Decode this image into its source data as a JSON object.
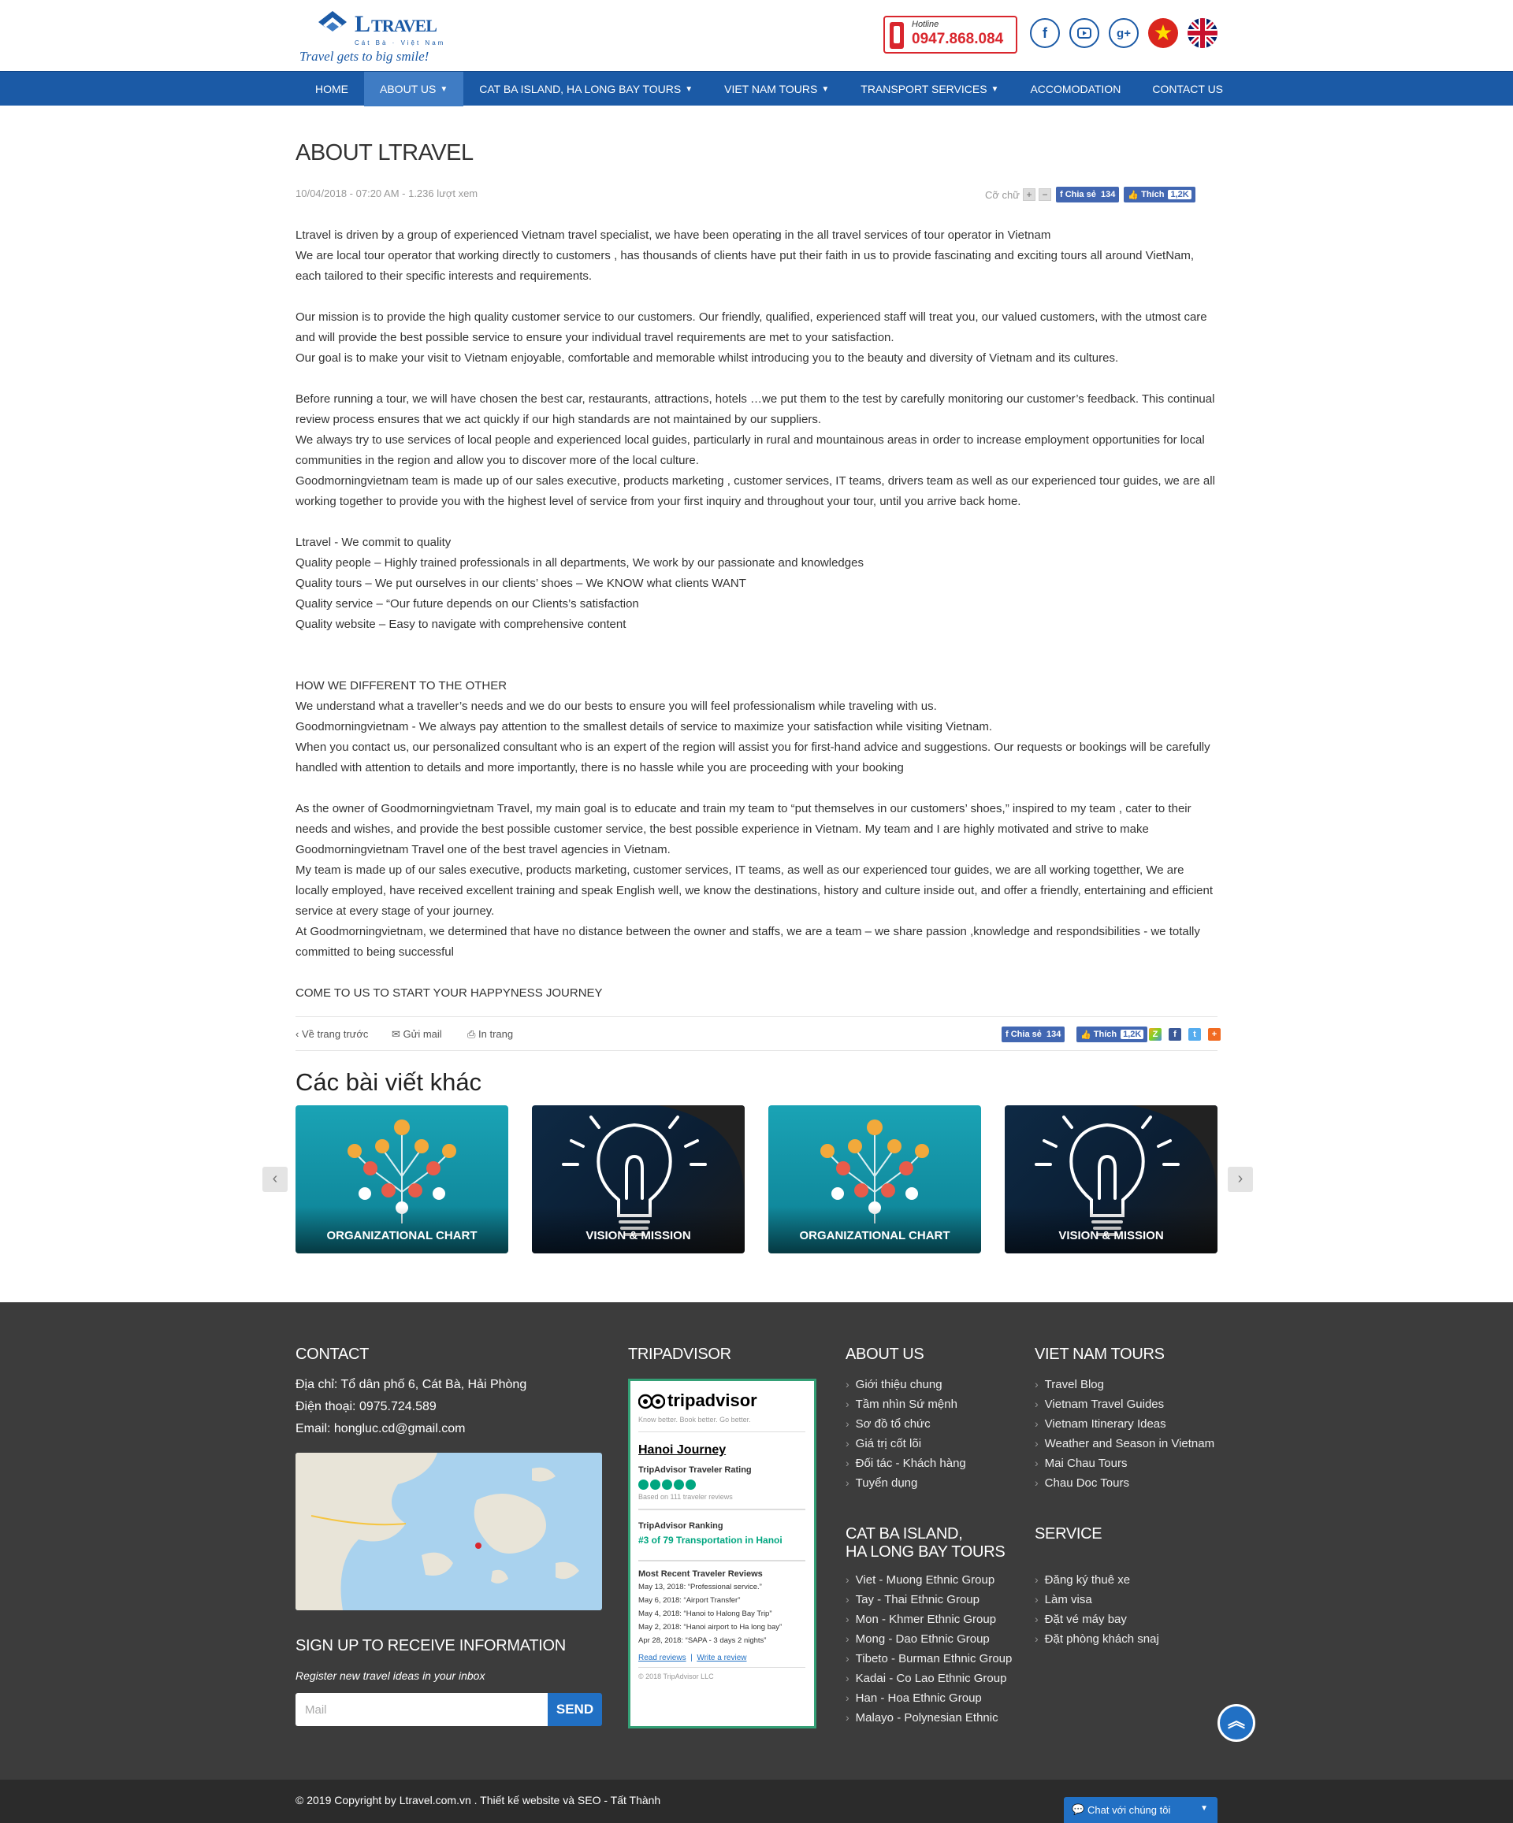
{
  "header": {
    "logo_name": "L",
    "logo_name_rest": "TRAVEL",
    "logo_sub": "Cát Bà · Việt Nam",
    "slogan": "Travel gets to big smile!",
    "hotline_label": "Hotline",
    "hotline_number": "0947.868.084",
    "social": [
      "facebook-icon",
      "youtube-icon",
      "google-plus-icon"
    ],
    "flags": [
      "vietnam-flag-icon",
      "uk-flag-icon"
    ]
  },
  "nav": [
    {
      "label": "HOME",
      "dropdown": false
    },
    {
      "label": "ABOUT US",
      "dropdown": true,
      "active": true
    },
    {
      "label": "CAT BA ISLAND, HA LONG BAY TOURS",
      "dropdown": true
    },
    {
      "label": "VIET NAM TOURS",
      "dropdown": true
    },
    {
      "label": "TRANSPORT SERVICES",
      "dropdown": true
    },
    {
      "label": "ACCOMODATION",
      "dropdown": false
    },
    {
      "label": "CONTACT US",
      "dropdown": false
    }
  ],
  "article": {
    "title": "ABOUT LTRAVEL",
    "meta": "10/04/2018 - 07:20 AM  - 1.236 lượt xem",
    "font_label": "Cỡ chữ",
    "share_label": "Chia sẻ",
    "share_count": "134",
    "like_label": "Thích",
    "like_count": "1,2K",
    "paragraphs": [
      "Ltravel  is driven by a group of experienced Vietnam travel specialist, we have been operating in the all travel services of tour operator in Vietnam",
      "We are local  tour operator  that working directly to customers , has thousands of clients have put their faith in us to provide fascinating and  exciting tours  all around VietNam, each tailored to their specific interests and requirements.",
      "",
      "Our mission is to provide the high quality customer service to our customers. Our friendly, qualified, experienced staff will treat you, our valued customers, with the utmost care and will provide the best possible service to ensure your individual travel requirements are met to your satisfaction.",
      "Our goal is to make your visit to Vietnam enjoyable, comfortable and memorable whilst introducing you to the beauty and diversity of Vietnam and its cultures.",
      "",
      "Before running a tour,  we will have chosen the best car, restaurants, attractions, hotels …we put them to the test by carefully monitoring our customer’s feedback. This continual review process ensures that we act quickly if our high standards are not maintained by our suppliers.",
      "We always try to use services of  local people and experienced local guides, particularly in rural and mountainous areas in order to increase employment opportu­nities for local  communities in the region and allow you to discover more of the local culture.",
      "Goodmorningvietnam  team is made up of our sales executive, products marketing , customer services, IT teams, drivers team  as well as our experienced tour guides, we are all working together to provide you with the highest level of service from your first inquiry and throughout your tour, until you arrive back home.",
      "",
      "Ltravel - We commit to quality",
      "Quality people – Highly trained professionals in all departments, We work by our passionate and knowledges",
      "Quality tours – We put ourselves in our clients’ shoes – We KNOW what clients WANT",
      "Quality service – “Our future depends on our Clients’s satisfaction",
      "Quality website – Easy to navigate with comprehensive content",
      "",
      "",
      "HOW WE DIFFERENT TO THE OTHER",
      "We understand  what a traveller’s  needs and we do our bests to ensure you will feel professionalism while traveling with us.",
      "Goodmorningvietnam -  We  always  pay attention to the smallest details of service to maximize your satisfaction while visiting Vietnam.",
      "When  you contact us, our personalized consultant who is an expert of the region will assist you  for first-hand advice and suggestions. Our requests or bookings will be carefully handled with attention to details and more importantly, there is no hassle while you are proceeding with your  booking",
      "",
      "As the owner of Goodmorningvietnam Travel, my main goal is to educate and train my team to “put themselves in our customers’ shoes,” inspired to my team , cater to their needs and wishes, and provide the best possible customer service, the best possible experience in Vietnam. My team and I are highly motivated and strive to make Goodmorningvietnam Travel one of the best travel agencies in Vietnam.",
      "My team is made up of our sales executive, products marketing, customer services, IT teams, as well as our experienced tour guides, we are all working togetther, We are locally employed, have received excellent training and speak English well, we know the destinations, history and culture inside out, and offer a friendly, en­tertaining and efficient service at every stage of your journey.",
      "At Goodmorningvietnam, we determined that have no distance  between the owner and staffs, we are a team – we share passion ,knowledge and respondsibili­ties -  we totally committed to being successful",
      "",
      "COME TO US TO START YOUR HAPPYNESS JOURNEY"
    ]
  },
  "toolbar": {
    "back": "Về trang trước",
    "mail": "Gửi mail",
    "print": "In trang"
  },
  "related": {
    "title": "Các bài viết khác",
    "cards": [
      "ORGANIZATIONAL CHART",
      "VISION & MISSION",
      "ORGANIZATIONAL CHART",
      "VISION & MISSION"
    ]
  },
  "footer": {
    "contact": {
      "heading": "CONTACT",
      "address": "Địa chỉ: Tổ dân phố 6, Cát Bà, Hải Phòng",
      "phone": "Điện thoại: 0975.724.589",
      "email": "Email: hongluc.cd@gmail.com"
    },
    "tripadvisor": {
      "heading": "TRIPADVISOR",
      "brand": "tripadvisor",
      "tagline": "Know better. Book better. Go better.",
      "name": "Hanoi Journey",
      "rating_label": "TripAdvisor Traveler Rating",
      "reviews_count": "Based on 111 traveler reviews",
      "ranking_label": "TripAdvisor Ranking",
      "ranking": "#3 of 79 Transportation in Hanoi",
      "recent_label": "Most Recent Traveler Reviews",
      "reviews": [
        "May 13, 2018: “Professional service.”",
        "May 6, 2018: “Airport Transfer”",
        "May 4, 2018: “Hanoi to Halong Bay Trip”",
        "May 2, 2018: “Hanoi airport to Ha long bay”",
        "Apr 28, 2018: “SAPA - 3 days 2 nights”"
      ],
      "read": "Read reviews",
      "write": "Write a review",
      "copy": "© 2018 TripAdvisor LLC"
    },
    "about": {
      "heading": "ABOUT US",
      "items": [
        "Giới thiệu chung",
        "Tầm nhìn Sứ mệnh",
        "Sơ đồ tổ chức",
        "Giá trị cốt lõi",
        "Đối tác - Khách hàng",
        "Tuyển dụng"
      ]
    },
    "catba": {
      "heading1": "CAT BA ISLAND,",
      "heading2": "HA LONG BAY TOURS",
      "items": [
        "Viet - Muong Ethnic Group",
        "Tay - Thai Ethnic Group",
        "Mon - Khmer Ethnic Group",
        "Mong - Dao Ethnic Group",
        "Tibeto - Burman Ethnic Group",
        "Kadai - Co Lao Ethnic Group",
        "Han - Hoa Ethnic Group",
        "Malayo - Polynesian Ethnic"
      ]
    },
    "vntours": {
      "heading": "VIET NAM TOURS",
      "items": [
        "Travel Blog",
        "Vietnam Travel Guides",
        "Vietnam Itinerary Ideas",
        "Weather and Season in Vietnam",
        "Mai Chau Tours",
        "Chau Doc Tours"
      ]
    },
    "service": {
      "heading": "SERVICE",
      "items": [
        "Đăng ký thuê xe",
        "Làm visa",
        "Đặt vé máy bay",
        "Đặt phòng khách snaj"
      ]
    },
    "signup": {
      "heading": "SIGN UP TO RECEIVE INFORMATION",
      "sub": "Register new travel ideas in your inbox",
      "placeholder": "Mail",
      "button": "SEND"
    },
    "copyright": "© 2019 Copyright by Ltravel.com.vn . Thiết kế website và SEO - Tất Thành",
    "chat": "Chat với chúng tôi"
  },
  "colors": {
    "brand": "#1b5aa6",
    "hotline": "#d9262d",
    "footer": "#3c3c3c",
    "tripadvisor": "#34a076"
  }
}
